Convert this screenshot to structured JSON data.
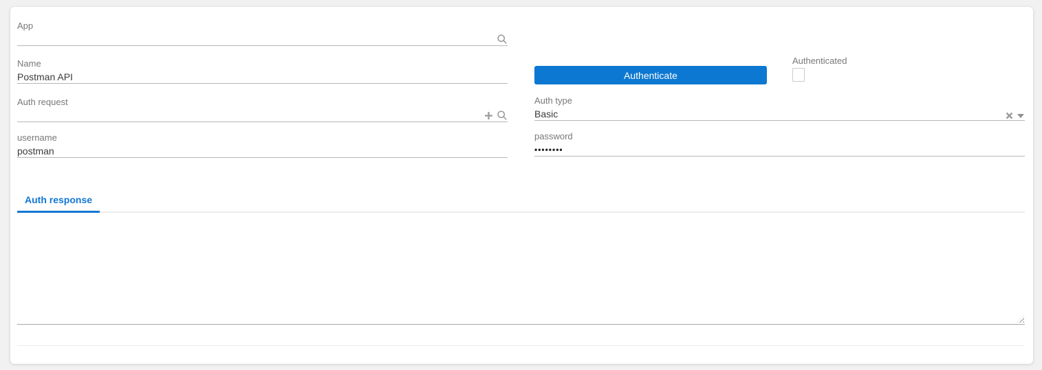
{
  "form": {
    "app": {
      "label": "App",
      "value": ""
    },
    "name": {
      "label": "Name",
      "value": "Postman API"
    },
    "auth_request": {
      "label": "Auth request",
      "value": ""
    },
    "auth_type": {
      "label": "Auth type",
      "value": "Basic"
    },
    "username": {
      "label": "username",
      "value": "postman"
    },
    "password": {
      "label": "password",
      "value": "••••••••"
    },
    "authenticate_button": {
      "label": "Authenticate"
    },
    "authenticated": {
      "label": "Authenticated",
      "checked": false
    },
    "tabs": [
      {
        "label": "Auth response",
        "active": true
      }
    ],
    "auth_response": {
      "value": ""
    }
  },
  "icons": {
    "app_lookup": "search-icon",
    "auth_request_new": "plus-icon",
    "auth_request_lookup": "search-icon",
    "auth_type_clear": "clear-icon",
    "auth_type_open": "caret-down-icon",
    "textarea_grip": "resize-handle-icon"
  },
  "colors": {
    "accent_blue": "#0d78d1",
    "tab_blue": "#1277d2",
    "page_background": "#f1f1f2",
    "card_background": "#ffffff",
    "label_text": "#787878",
    "value_text": "#3b3b3b",
    "input_underline": "#b6b6b6",
    "icon_gray": "#9a9a9a"
  }
}
